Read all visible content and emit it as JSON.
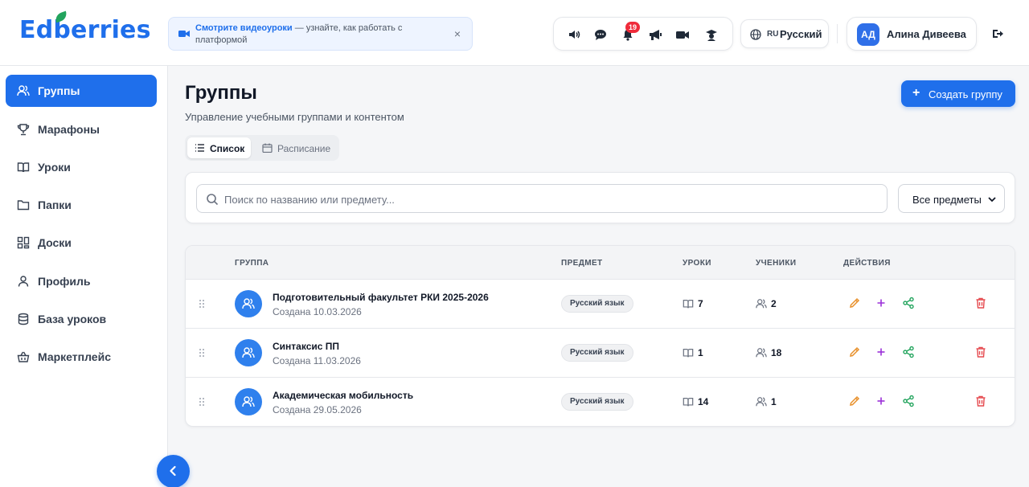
{
  "app": {
    "logo": "Edberries"
  },
  "notice": {
    "link": "Смотрите видеоуроки",
    "text": " — узнайте, как работать с платформой",
    "close": "×"
  },
  "header": {
    "notifications_count": "19",
    "lang_code": "RU",
    "lang_name": "Русский",
    "user_initials": "АД",
    "user_name": "Алина Дивеева"
  },
  "sidebar": {
    "items": [
      {
        "label": "Группы",
        "icon": "users-icon",
        "active": true
      },
      {
        "label": "Марафоны",
        "icon": "trophy-icon"
      },
      {
        "label": "Уроки",
        "icon": "book-icon"
      },
      {
        "label": "Папки",
        "icon": "folder-icon"
      },
      {
        "label": "Доски",
        "icon": "boards-icon"
      },
      {
        "label": "Профиль",
        "icon": "user-icon"
      },
      {
        "label": "База уроков",
        "icon": "database-icon"
      },
      {
        "label": "Маркетплейс",
        "icon": "basket-icon"
      }
    ]
  },
  "main": {
    "title": "Группы",
    "subtitle": "Управление учебными группами и контентом",
    "create_button": "Создать группу",
    "tabs": [
      {
        "label": "Список",
        "active": true
      },
      {
        "label": "Расписание"
      }
    ],
    "search_placeholder": "Поиск по названию или предмету...",
    "subject_filter": "Все предметы"
  },
  "table": {
    "columns": {
      "group": "ГРУППА",
      "subject": "ПРЕДМЕТ",
      "lessons": "УРОКИ",
      "students": "УЧЕНИКИ",
      "actions": "ДЕЙСТВИЯ"
    },
    "rows": [
      {
        "name": "Подготовительный факультет РКИ 2025-2026",
        "created": "Создана 10.03.2026",
        "subject": "Русский язык",
        "lessons": "7",
        "students": "2"
      },
      {
        "name": "Синтаксис ПП",
        "created": "Создана 11.03.2026",
        "subject": "Русский язык",
        "lessons": "1",
        "students": "18"
      },
      {
        "name": "Академическая мобильность",
        "created": "Создана 29.05.2026",
        "subject": "Русский язык",
        "lessons": "14",
        "students": "1"
      }
    ]
  },
  "colors": {
    "accent": "#1f6feb",
    "edit": "#e8912d",
    "add": "#9b30d9",
    "share": "#22a45d",
    "delete": "#e5484d"
  }
}
